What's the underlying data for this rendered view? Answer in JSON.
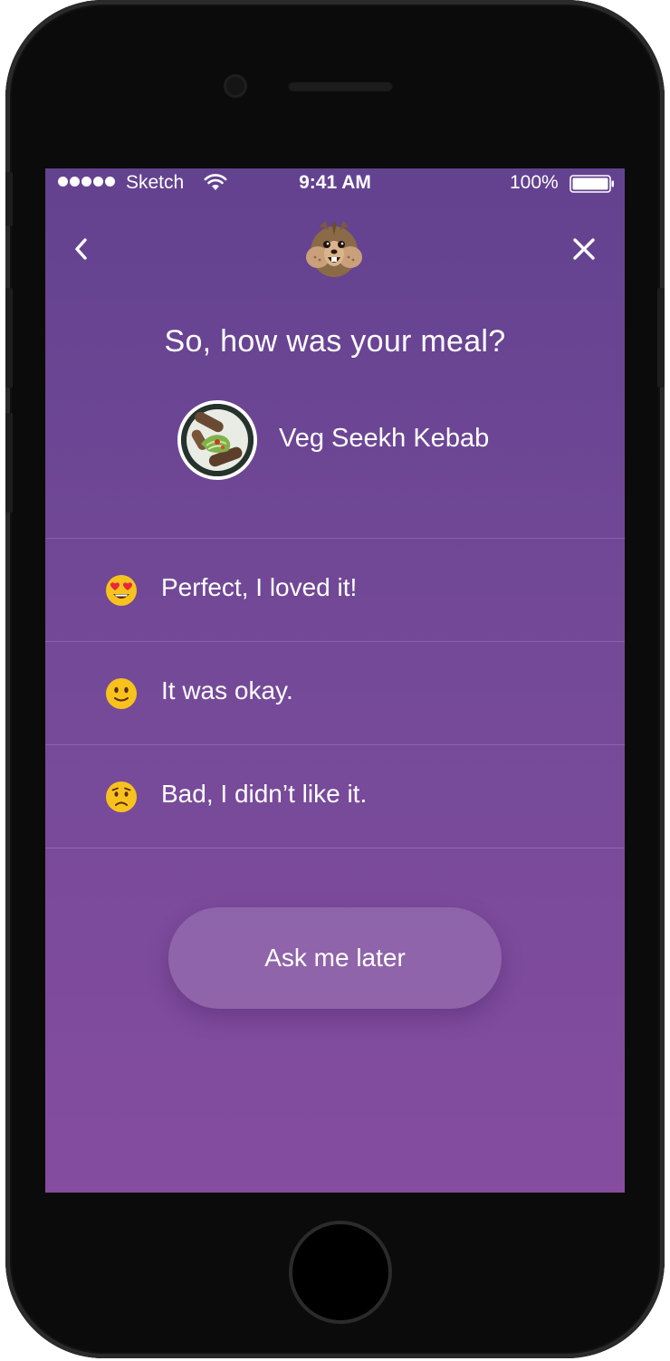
{
  "status_bar": {
    "carrier": "Sketch",
    "time": "9:41 AM",
    "battery": "100%",
    "icons": [
      "signal-dots-icon",
      "wifi-icon",
      "battery-icon"
    ]
  },
  "nav": {
    "back_icon": "chevron-left-icon",
    "mascot_icon": "squirrel-mascot-icon",
    "close_icon": "close-icon"
  },
  "prompt": {
    "question": "So, how was your meal?",
    "dish_name": "Veg Seekh Kebab"
  },
  "options": [
    {
      "emoji": "heart-eyes-emoji",
      "label": "Perfect, I loved it!"
    },
    {
      "emoji": "slight-smile-emoji",
      "label": "It was okay."
    },
    {
      "emoji": "worried-face-emoji",
      "label": "Bad, I didn’t like it."
    }
  ],
  "ask_later_label": "Ask me later",
  "colors": {
    "screen_top": "#63428f",
    "screen_bottom": "#854c9f",
    "emoji_yellow": "#f7c21d"
  }
}
